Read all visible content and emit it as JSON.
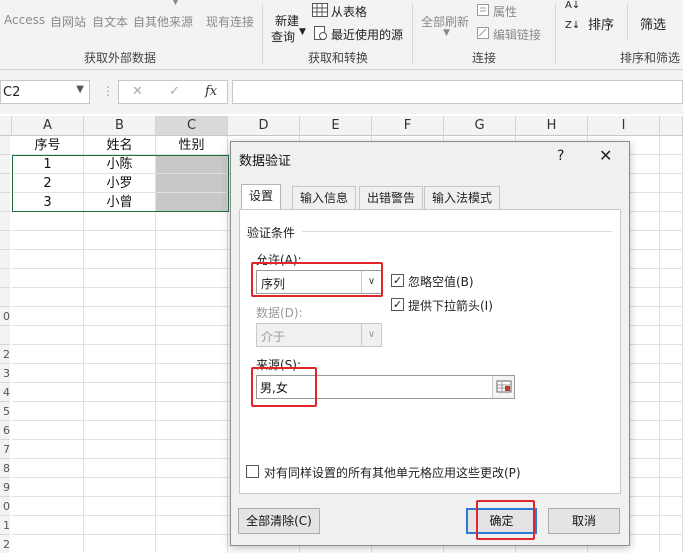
{
  "ribbon": {
    "external_data": {
      "access_label": "Access",
      "web_label": "自网站",
      "text_label": "自文本",
      "other_sources_label": "自其他来源",
      "existing_conn_label": "现有连接",
      "group_label": "获取外部数据"
    },
    "get_transform": {
      "new_query_label": "新建",
      "new_query_label2": "查询",
      "from_table_label": "从表格",
      "recent_sources_label": "最近使用的源",
      "group_label": "获取和转换"
    },
    "connections": {
      "refresh_all_label": "全部刷新",
      "properties_label": "属性",
      "edit_links_label": "编辑链接",
      "group_label": "连接"
    },
    "sort_filter": {
      "sort_label": "排序",
      "filter_label": "筛选",
      "group_label": "排序和筛选"
    }
  },
  "formula_bar": {
    "name_box_value": "C2",
    "cancel_glyph": "✕",
    "enter_glyph": "✓",
    "fx_glyph": "fx",
    "formula_value": ""
  },
  "sheet": {
    "columns": [
      "A",
      "B",
      "C",
      "D",
      "E",
      "F",
      "G",
      "H",
      "I"
    ],
    "row_numbers": [
      "",
      "",
      "",
      "",
      "",
      "",
      "",
      "",
      "",
      "0",
      "",
      "2",
      "3",
      "4",
      "5",
      "6",
      "7",
      "8",
      "9",
      "0",
      "1",
      "2"
    ],
    "header_row": [
      "序号",
      "姓名",
      "性别"
    ],
    "rows": [
      [
        "1",
        "小陈",
        ""
      ],
      [
        "2",
        "小罗",
        ""
      ],
      [
        "3",
        "小曾",
        ""
      ]
    ]
  },
  "dialog": {
    "title": "数据验证",
    "help_glyph": "?",
    "close_glyph": "✕",
    "tabs": [
      "设置",
      "输入信息",
      "出错警告",
      "输入法模式"
    ],
    "section_title": "验证条件",
    "allow_label": "允许(A):",
    "allow_value": "序列",
    "ignore_blank_label": "忽略空值(B)",
    "ignore_blank_checked": true,
    "dropdown_label": "提供下拉箭头(I)",
    "dropdown_checked": true,
    "data_label": "数据(D):",
    "data_value": "介于",
    "source_label": "来源(S):",
    "source_value": "男,女",
    "apply_all_label": "对有同样设置的所有其他单元格应用这些更改(P)",
    "apply_all_checked": false,
    "clear_all_label": "全部清除(C)",
    "ok_label": "确定",
    "cancel_label": "取消",
    "check_glyph": "✓",
    "dropdown_arrow": "∨"
  },
  "colors": {
    "highlight_red": "#e0262b",
    "table_border": "#1d6f3f",
    "selected_fill": "#c8c8c8"
  }
}
